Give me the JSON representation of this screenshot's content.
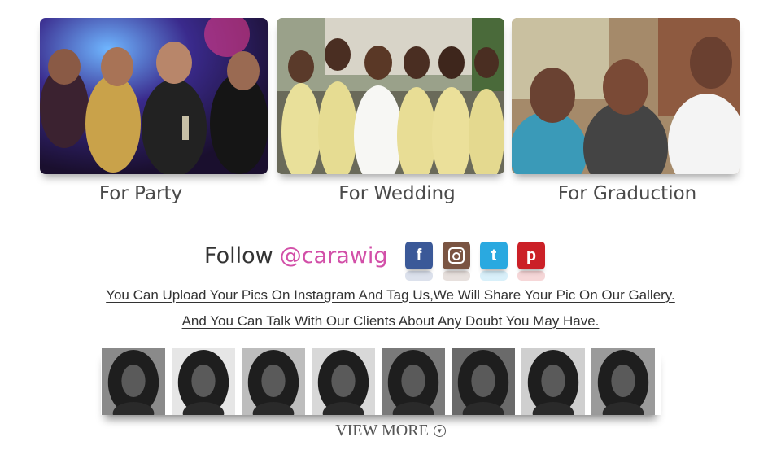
{
  "occasions": [
    {
      "label": "For Party"
    },
    {
      "label": "For Wedding"
    },
    {
      "label": "For Graduction"
    }
  ],
  "follow": {
    "prefix": "Follow",
    "handle": "@carawig",
    "handle_color": "#d24fa8"
  },
  "social": [
    {
      "icon": "facebook-icon",
      "glyph": "f",
      "color": "#3b5998"
    },
    {
      "icon": "instagram-icon",
      "glyph": "◙",
      "color": "#7a5442"
    },
    {
      "icon": "twitter-icon",
      "glyph": "t",
      "color": "#2aa9e0"
    },
    {
      "icon": "pinterest-icon",
      "glyph": "p",
      "color": "#cb2027"
    }
  ],
  "info": {
    "line1": "You Can Upload Your Pics On Instagram And Tag Us,We Will Share Your Pic On Our Gallery.",
    "line2": "And You Can Talk With Our Clients About Any Doubt You May Have."
  },
  "gallery": {
    "photo_count": 8
  },
  "view_more": {
    "label": "VIEW MORE",
    "icon": "chevron-down-circle-icon"
  }
}
